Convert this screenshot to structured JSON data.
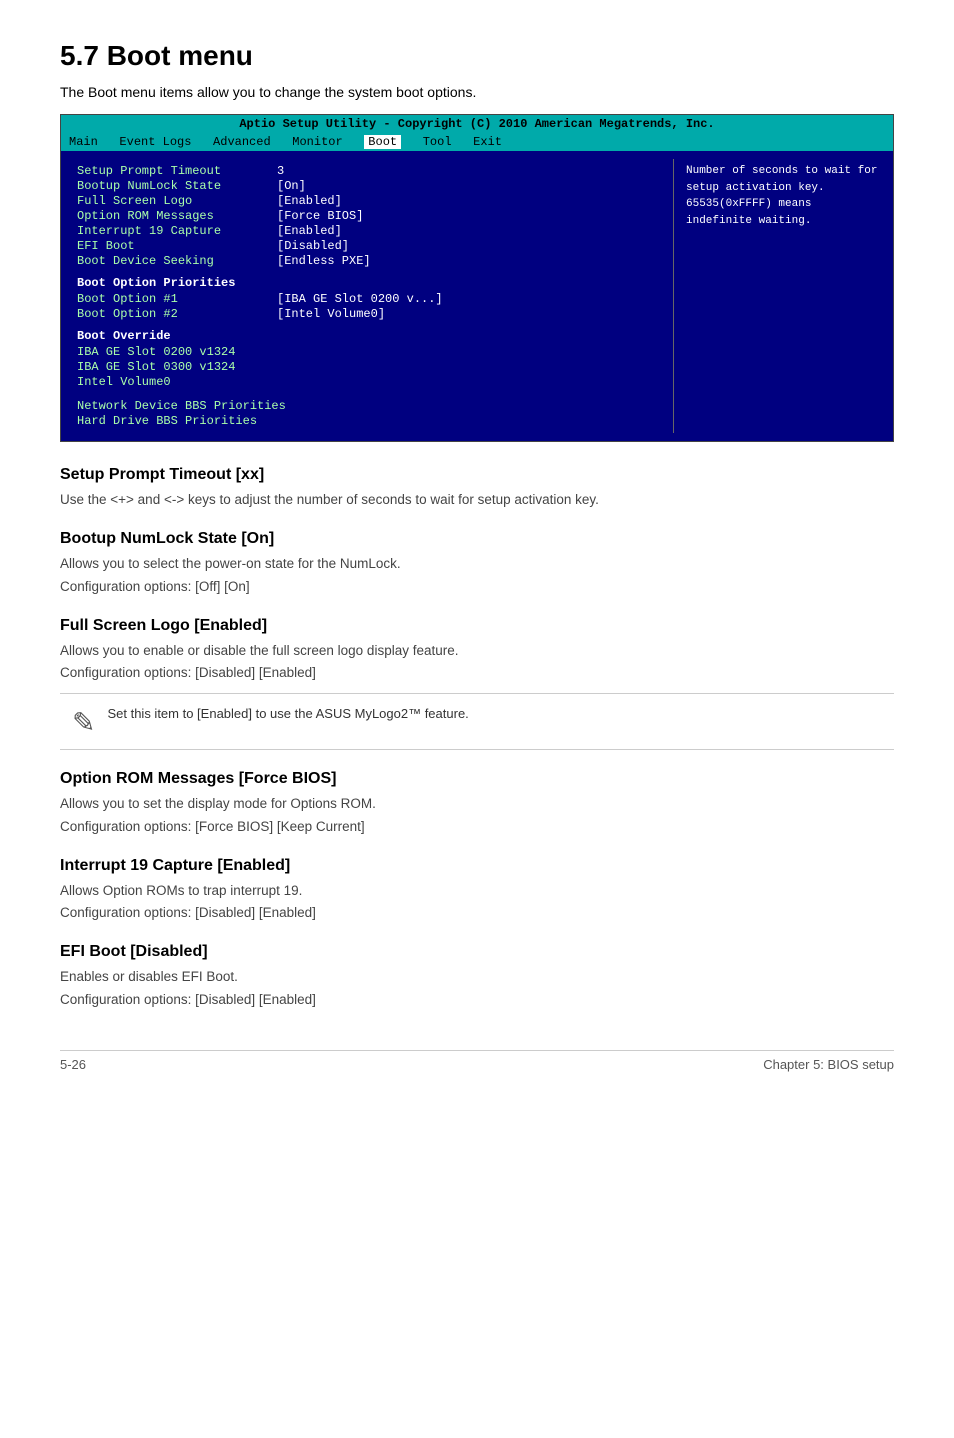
{
  "page": {
    "title": "5.7   Boot menu",
    "intro": "The Boot menu items allow you to change the system boot options."
  },
  "bios": {
    "title_bar": "Aptio Setup Utility - Copyright (C) 2010 American Megatrends, Inc.",
    "menu_items": [
      "Main",
      "Event Logs",
      "Advanced",
      "Monitor",
      "Boot",
      "Tool",
      "Exit"
    ],
    "active_menu": "Boot",
    "rows": [
      {
        "label": "Setup Prompt Timeout",
        "value": "3"
      },
      {
        "label": "Bootup NumLock State",
        "value": "[On]"
      },
      {
        "label": "Full Screen Logo",
        "value": "[Enabled]"
      },
      {
        "label": "Option ROM Messages",
        "value": "[Force BIOS]"
      },
      {
        "label": "Interrupt 19 Capture",
        "value": "[Enabled]"
      },
      {
        "label": "EFI Boot",
        "value": "[Disabled]"
      },
      {
        "label": "Boot Device Seeking",
        "value": "[Endless PXE]"
      }
    ],
    "priorities_header": "Boot Option Priorities",
    "priorities": [
      {
        "label": "Boot Option #1",
        "value": "[IBA GE Slot 0200 v...]"
      },
      {
        "label": "Boot Option #2",
        "value": "[Intel Volume0]"
      }
    ],
    "override_header": "Boot Override",
    "override_items": [
      "IBA GE Slot 0200 v1324",
      "IBA GE Slot 0300 v1324",
      "Intel Volume0"
    ],
    "bottom_items": [
      "Network Device BBS Priorities",
      "Hard Drive BBS Priorities"
    ],
    "help_text": "Number of seconds to wait for setup activation key. 65535(0xFFFF) means indefinite waiting."
  },
  "sections": [
    {
      "id": "setup-prompt-timeout",
      "heading": "Setup Prompt Timeout [xx]",
      "paragraphs": [
        "Use the <+> and <-> keys to adjust the number of seconds to wait for setup activation key."
      ]
    },
    {
      "id": "bootup-numlock-state",
      "heading": "Bootup NumLock State [On]",
      "paragraphs": [
        "Allows you to select the power-on state for the NumLock.",
        "Configuration options: [Off] [On]"
      ]
    },
    {
      "id": "full-screen-logo",
      "heading": "Full Screen Logo [Enabled]",
      "paragraphs": [
        "Allows you to enable or disable the full screen logo display feature.",
        "Configuration options: [Disabled] [Enabled]"
      ],
      "note": "Set this item to [Enabled] to use the ASUS MyLogo2™ feature."
    },
    {
      "id": "option-rom-messages",
      "heading": "Option ROM Messages [Force BIOS]",
      "paragraphs": [
        "Allows you to set the display mode for Options ROM.",
        "Configuration options: [Force BIOS] [Keep Current]"
      ]
    },
    {
      "id": "interrupt-19-capture",
      "heading": "Interrupt 19 Capture [Enabled]",
      "paragraphs": [
        "Allows Option ROMs to trap interrupt 19.",
        "Configuration options: [Disabled] [Enabled]"
      ]
    },
    {
      "id": "efi-boot",
      "heading": "EFI Boot [Disabled]",
      "paragraphs": [
        "Enables or disables EFI Boot.",
        "Configuration options: [Disabled] [Enabled]"
      ]
    }
  ],
  "footer": {
    "left": "5-26",
    "right": "Chapter 5: BIOS setup"
  }
}
